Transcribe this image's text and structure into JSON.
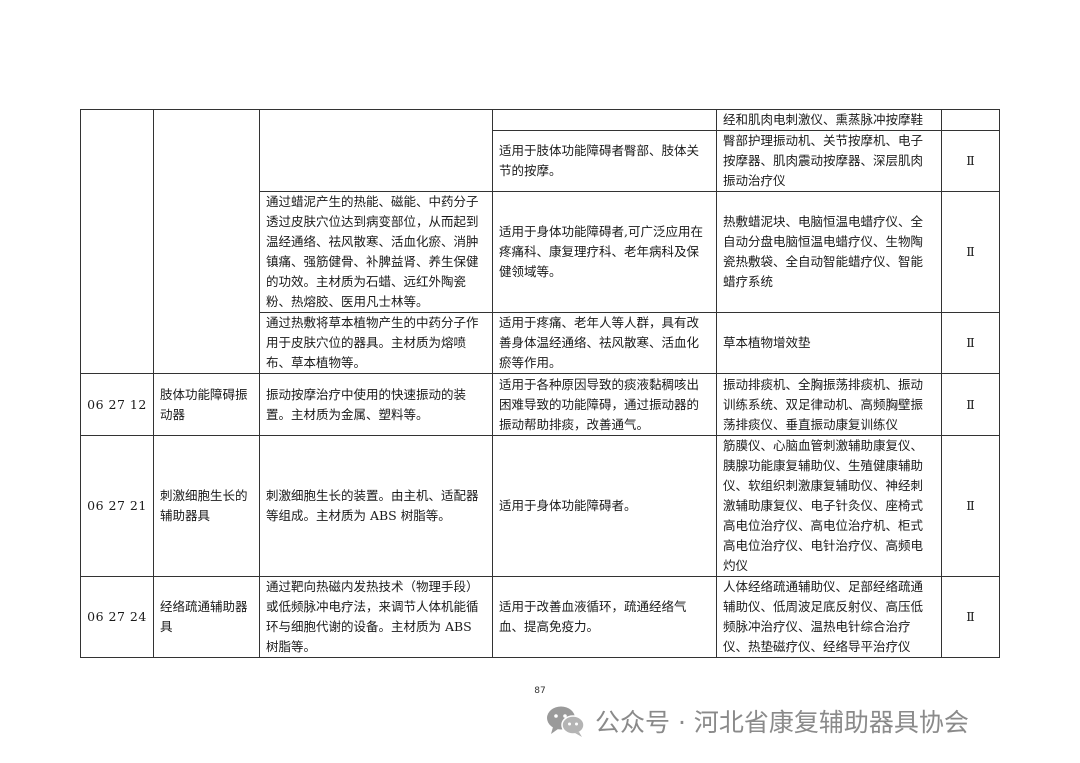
{
  "table": {
    "rows": [
      {
        "code": "",
        "name": "",
        "description": "",
        "applicable": "",
        "products": "经和肌肉电刺激仪、熏蒸脉冲按摩鞋",
        "class": ""
      },
      {
        "code": "",
        "name": "",
        "description": "",
        "applicable": "适用于肢体功能障碍者臀部、肢体关节的按摩。",
        "products": "臀部护理振动机、关节按摩机、电子按摩器、肌肉震动按摩器、深层肌肉振动治疗仪",
        "class": "Ⅱ"
      },
      {
        "code": "",
        "name": "",
        "description": "通过蜡泥产生的热能、磁能、中药分子透过皮肤穴位达到病变部位，从而起到温经通络、祛风散寒、活血化瘀、消肿镇痛、强筋健骨、补脾益肾、养生保健的功效。主材质为石蜡、远红外陶瓷粉、热熔胶、医用凡士林等。",
        "applicable": "适用于身体功能障碍者,可广泛应用在疼痛科、康复理疗科、老年病科及保健领域等。",
        "products": "热敷蜡泥块、电脑恒温电蜡疗仪、全自动分盘电脑恒温电蜡疗仪、生物陶瓷热敷袋、全自动智能蜡疗仪、智能蜡疗系统",
        "class": "Ⅱ"
      },
      {
        "code": "",
        "name": "",
        "description": "通过热敷将草本植物产生的中药分子作用于皮肤穴位的器具。主材质为熔喷布、草本植物等。",
        "applicable": "适用于疼痛、老年人等人群，具有改善身体温经通络、祛风散寒、活血化瘀等作用。",
        "products": "草本植物增效垫",
        "class": "Ⅱ"
      },
      {
        "code": "06 27 12",
        "name": "肢体功能障碍振动器",
        "description": "振动按摩治疗中使用的快速振动的装置。主材质为金属、塑料等。",
        "applicable": "适用于各种原因导致的痰液黏稠咳出困难导致的功能障碍，通过振动器的振动帮助排痰，改善通气。",
        "products": "振动排痰机、全胸振荡排痰机、振动训练系统、双足律动机、高频胸壁振荡排痰仪、垂直振动康复训练仪",
        "class": "Ⅱ"
      },
      {
        "code": "06 27 21",
        "name": "刺激细胞生长的辅助器具",
        "description": "刺激细胞生长的装置。由主机、适配器等组成。主材质为 ABS 树脂等。",
        "applicable": "适用于身体功能障碍者。",
        "products": "筋膜仪、心脑血管刺激辅助康复仪、胰腺功能康复辅助仪、生殖健康辅助仪、软组织刺激康复辅助仪、神经刺激辅助康复仪、电子针灸仪、座椅式高电位治疗仪、高电位治疗机、柜式高电位治疗仪、电针治疗仪、高频电灼仪",
        "class": "Ⅱ"
      },
      {
        "code": "06 27 24",
        "name": "经络疏通辅助器具",
        "description": "通过靶向热磁内发热技术（物理手段）或低频脉冲电疗法，来调节人体机能循环与细胞代谢的设备。主材质为 ABS 树脂等。",
        "applicable": "适用于改善血液循环，疏通经络气血、提高免疫力。",
        "products": "人体经络疏通辅助仪、足部经络疏通辅助仪、低周波足底反射仪、高压低频脉冲治疗仪、温热电针综合治疗仪、热垫磁疗仪、经络导平治疗仪",
        "class": "Ⅱ"
      }
    ]
  },
  "page_number": "87",
  "watermark": {
    "text": "公众号 · 河北省康复辅助器具协会",
    "icon": "wechat-icon"
  }
}
